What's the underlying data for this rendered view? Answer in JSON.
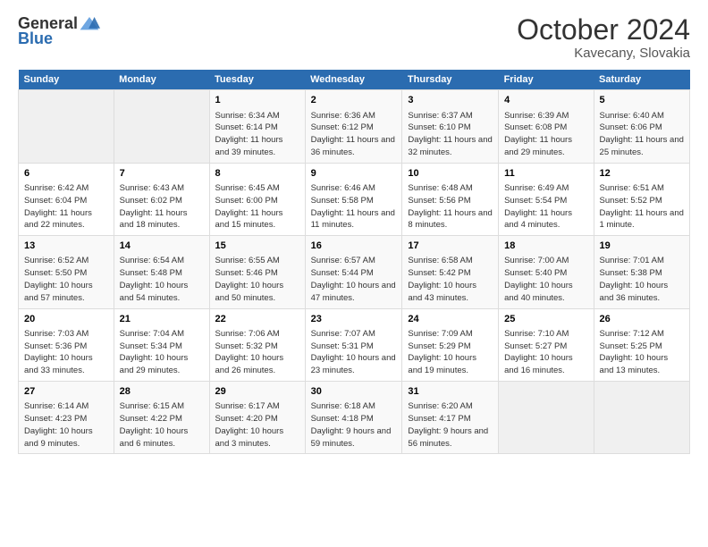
{
  "logo": {
    "general": "General",
    "blue": "Blue"
  },
  "header": {
    "month": "October 2024",
    "location": "Kavecany, Slovakia"
  },
  "weekdays": [
    "Sunday",
    "Monday",
    "Tuesday",
    "Wednesday",
    "Thursday",
    "Friday",
    "Saturday"
  ],
  "weeks": [
    [
      {
        "day": "",
        "info": ""
      },
      {
        "day": "",
        "info": ""
      },
      {
        "day": "1",
        "info": "Sunrise: 6:34 AM\nSunset: 6:14 PM\nDaylight: 11 hours and 39 minutes."
      },
      {
        "day": "2",
        "info": "Sunrise: 6:36 AM\nSunset: 6:12 PM\nDaylight: 11 hours and 36 minutes."
      },
      {
        "day": "3",
        "info": "Sunrise: 6:37 AM\nSunset: 6:10 PM\nDaylight: 11 hours and 32 minutes."
      },
      {
        "day": "4",
        "info": "Sunrise: 6:39 AM\nSunset: 6:08 PM\nDaylight: 11 hours and 29 minutes."
      },
      {
        "day": "5",
        "info": "Sunrise: 6:40 AM\nSunset: 6:06 PM\nDaylight: 11 hours and 25 minutes."
      }
    ],
    [
      {
        "day": "6",
        "info": "Sunrise: 6:42 AM\nSunset: 6:04 PM\nDaylight: 11 hours and 22 minutes."
      },
      {
        "day": "7",
        "info": "Sunrise: 6:43 AM\nSunset: 6:02 PM\nDaylight: 11 hours and 18 minutes."
      },
      {
        "day": "8",
        "info": "Sunrise: 6:45 AM\nSunset: 6:00 PM\nDaylight: 11 hours and 15 minutes."
      },
      {
        "day": "9",
        "info": "Sunrise: 6:46 AM\nSunset: 5:58 PM\nDaylight: 11 hours and 11 minutes."
      },
      {
        "day": "10",
        "info": "Sunrise: 6:48 AM\nSunset: 5:56 PM\nDaylight: 11 hours and 8 minutes."
      },
      {
        "day": "11",
        "info": "Sunrise: 6:49 AM\nSunset: 5:54 PM\nDaylight: 11 hours and 4 minutes."
      },
      {
        "day": "12",
        "info": "Sunrise: 6:51 AM\nSunset: 5:52 PM\nDaylight: 11 hours and 1 minute."
      }
    ],
    [
      {
        "day": "13",
        "info": "Sunrise: 6:52 AM\nSunset: 5:50 PM\nDaylight: 10 hours and 57 minutes."
      },
      {
        "day": "14",
        "info": "Sunrise: 6:54 AM\nSunset: 5:48 PM\nDaylight: 10 hours and 54 minutes."
      },
      {
        "day": "15",
        "info": "Sunrise: 6:55 AM\nSunset: 5:46 PM\nDaylight: 10 hours and 50 minutes."
      },
      {
        "day": "16",
        "info": "Sunrise: 6:57 AM\nSunset: 5:44 PM\nDaylight: 10 hours and 47 minutes."
      },
      {
        "day": "17",
        "info": "Sunrise: 6:58 AM\nSunset: 5:42 PM\nDaylight: 10 hours and 43 minutes."
      },
      {
        "day": "18",
        "info": "Sunrise: 7:00 AM\nSunset: 5:40 PM\nDaylight: 10 hours and 40 minutes."
      },
      {
        "day": "19",
        "info": "Sunrise: 7:01 AM\nSunset: 5:38 PM\nDaylight: 10 hours and 36 minutes."
      }
    ],
    [
      {
        "day": "20",
        "info": "Sunrise: 7:03 AM\nSunset: 5:36 PM\nDaylight: 10 hours and 33 minutes."
      },
      {
        "day": "21",
        "info": "Sunrise: 7:04 AM\nSunset: 5:34 PM\nDaylight: 10 hours and 29 minutes."
      },
      {
        "day": "22",
        "info": "Sunrise: 7:06 AM\nSunset: 5:32 PM\nDaylight: 10 hours and 26 minutes."
      },
      {
        "day": "23",
        "info": "Sunrise: 7:07 AM\nSunset: 5:31 PM\nDaylight: 10 hours and 23 minutes."
      },
      {
        "day": "24",
        "info": "Sunrise: 7:09 AM\nSunset: 5:29 PM\nDaylight: 10 hours and 19 minutes."
      },
      {
        "day": "25",
        "info": "Sunrise: 7:10 AM\nSunset: 5:27 PM\nDaylight: 10 hours and 16 minutes."
      },
      {
        "day": "26",
        "info": "Sunrise: 7:12 AM\nSunset: 5:25 PM\nDaylight: 10 hours and 13 minutes."
      }
    ],
    [
      {
        "day": "27",
        "info": "Sunrise: 6:14 AM\nSunset: 4:23 PM\nDaylight: 10 hours and 9 minutes."
      },
      {
        "day": "28",
        "info": "Sunrise: 6:15 AM\nSunset: 4:22 PM\nDaylight: 10 hours and 6 minutes."
      },
      {
        "day": "29",
        "info": "Sunrise: 6:17 AM\nSunset: 4:20 PM\nDaylight: 10 hours and 3 minutes."
      },
      {
        "day": "30",
        "info": "Sunrise: 6:18 AM\nSunset: 4:18 PM\nDaylight: 9 hours and 59 minutes."
      },
      {
        "day": "31",
        "info": "Sunrise: 6:20 AM\nSunset: 4:17 PM\nDaylight: 9 hours and 56 minutes."
      },
      {
        "day": "",
        "info": ""
      },
      {
        "day": "",
        "info": ""
      }
    ]
  ]
}
